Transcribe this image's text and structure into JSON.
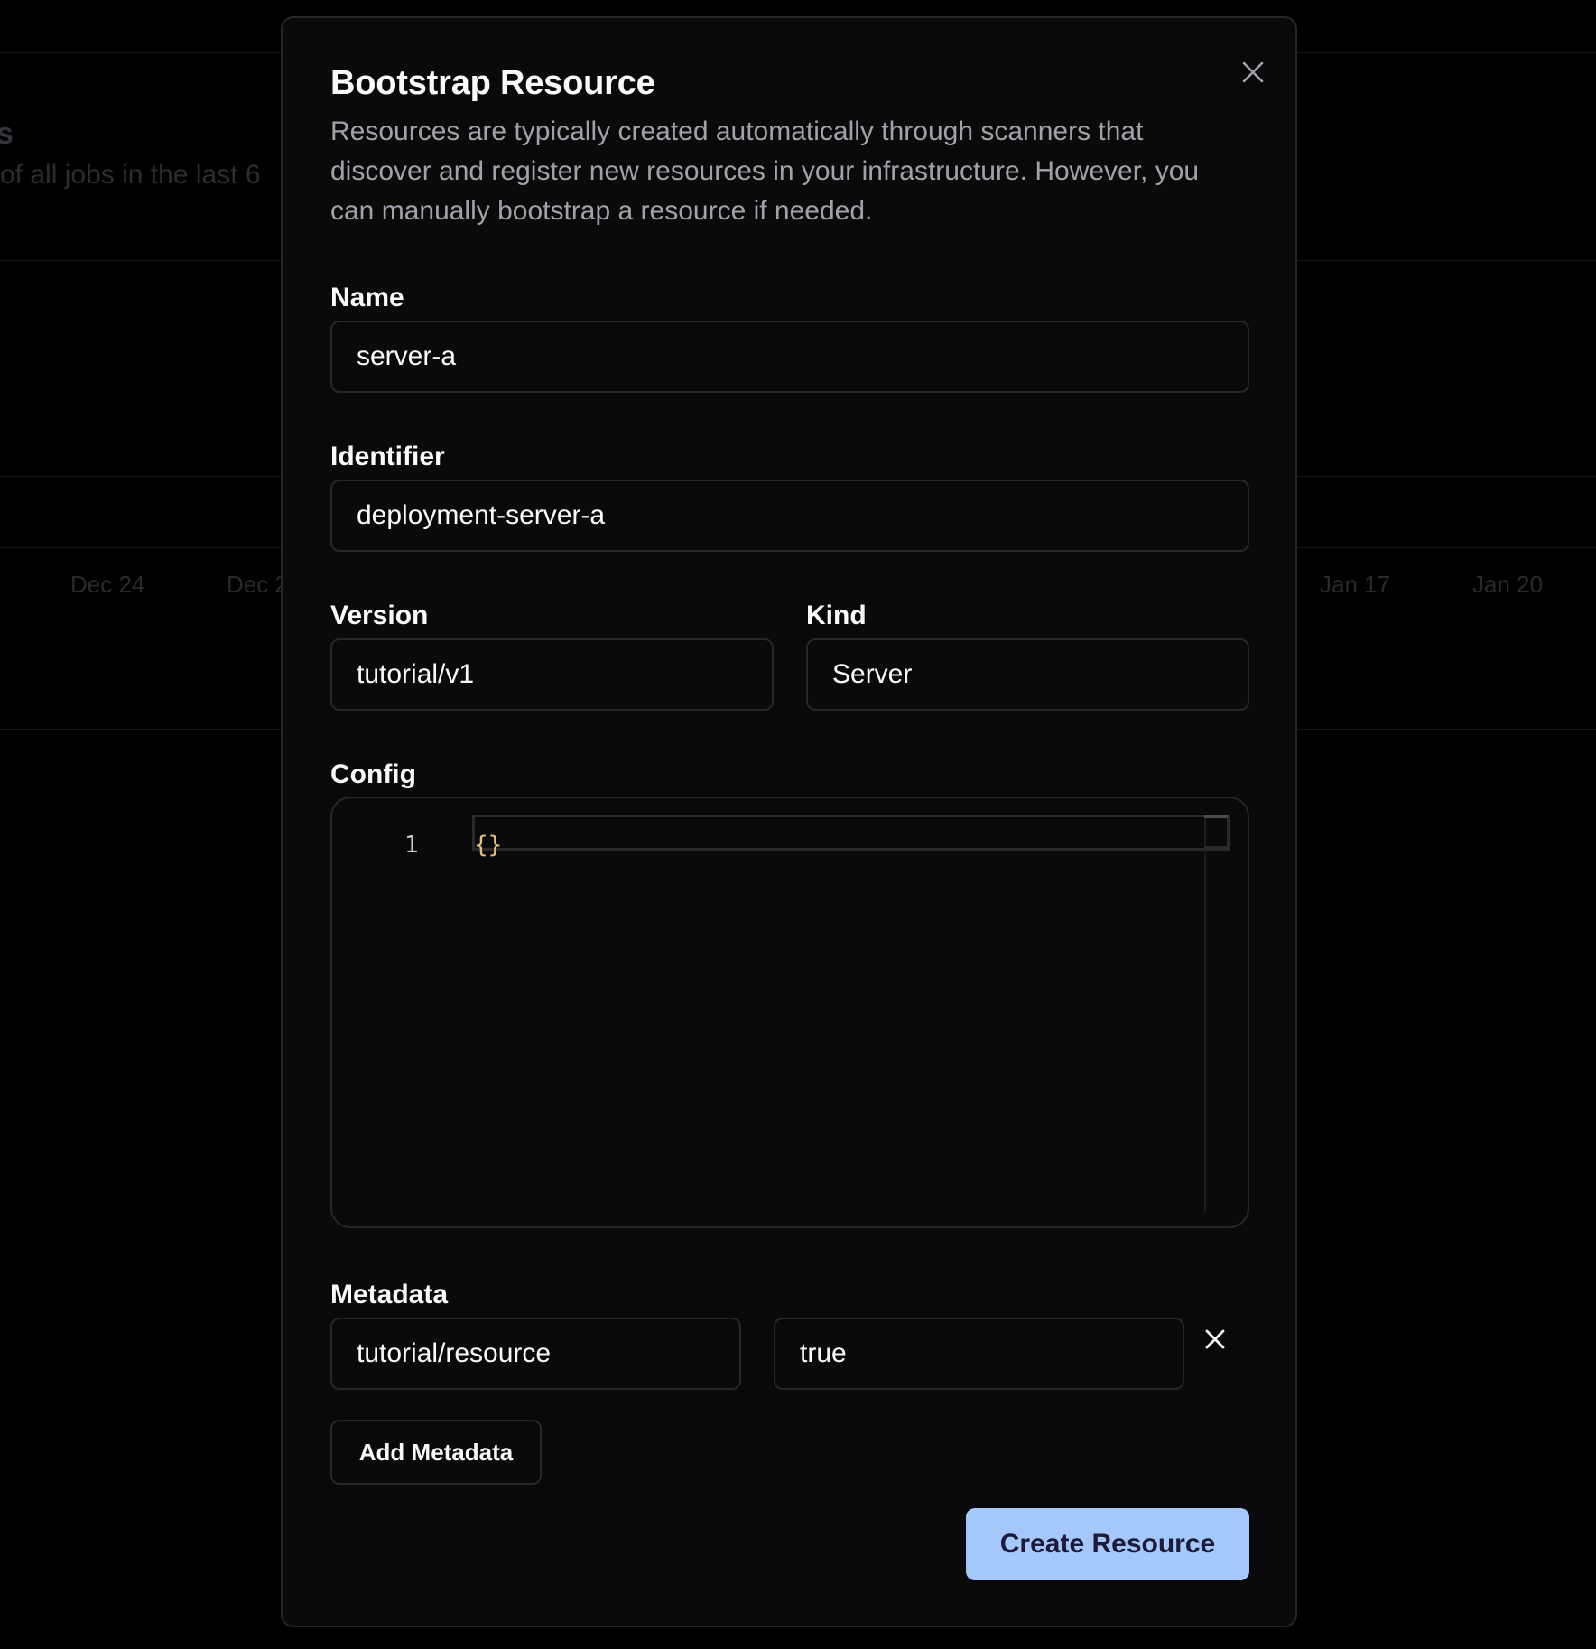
{
  "background": {
    "title_fragment": "s",
    "subtitle_fragment": "of all jobs in the last 6",
    "axis_ticks": [
      "Dec 24",
      "Dec 2",
      "Jan 17",
      "Jan 20"
    ]
  },
  "dialog": {
    "title": "Bootstrap Resource",
    "description": "Resources are typically created automatically through scanners that discover and register new resources in your infrastructure. However, you can manually bootstrap a resource if needed.",
    "close_icon": "close-icon",
    "fields": {
      "name": {
        "label": "Name",
        "value": "server-a"
      },
      "identifier": {
        "label": "Identifier",
        "value": "deployment-server-a"
      },
      "version": {
        "label": "Version",
        "value": "tutorial/v1"
      },
      "kind": {
        "label": "Kind",
        "value": "Server"
      }
    },
    "config": {
      "label": "Config",
      "line_number": "1",
      "code": "{}"
    },
    "metadata": {
      "label": "Metadata",
      "entries": [
        {
          "key": "tutorial/resource",
          "value": "true"
        }
      ],
      "remove_icon": "x-icon",
      "add_label": "Add Metadata"
    },
    "submit_label": "Create Resource"
  },
  "colors": {
    "primary_button": "#a5c8fa",
    "primary_button_text": "#1e1b3a",
    "code_brace": "#e5c07b",
    "muted_text": "#a1a1aa"
  }
}
